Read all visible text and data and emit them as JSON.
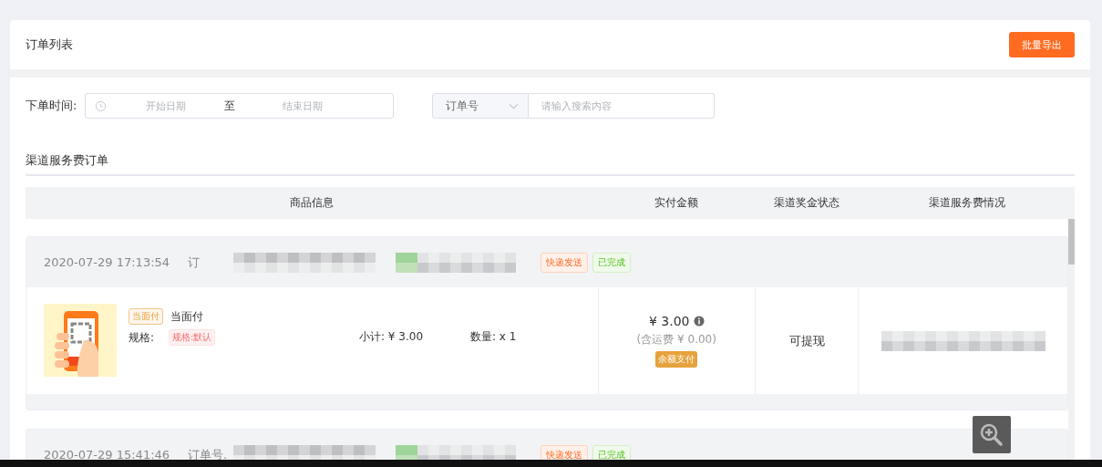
{
  "header": {
    "title": "订单列表",
    "export_button": "批量导出"
  },
  "filters": {
    "date_label": "下单时间:",
    "start_placeholder": "开始日期",
    "separator": "至",
    "end_placeholder": "结束日期",
    "search_type": "订单号",
    "search_placeholder": "请输入搜索内容"
  },
  "section_title": "渠道服务费订单",
  "table": {
    "columns": [
      "商品信息",
      "实付金额",
      "渠道奖金状态",
      "渠道服务费情况"
    ],
    "orders": [
      {
        "time": "2020-07-29 17:13:54",
        "order_label": "订",
        "tags": [
          {
            "text": "快递发送",
            "kind": "shipping"
          },
          {
            "text": "已完成",
            "kind": "done"
          }
        ],
        "detail": {
          "product_badge": "当面付",
          "product_name": "当面付",
          "spec_label": "规格:",
          "spec_tag": "规格:默认",
          "subtotal": "小计: ¥ 3.00",
          "quantity": "数量: x 1",
          "amount": "¥ 3.00",
          "shipping": "(含运费 ¥ 0.00)",
          "payment_badge": "余额支付",
          "bonus_status": "可提现"
        }
      },
      {
        "time": "2020-07-29 15:41:46",
        "order_label": "订单号.",
        "tags": [
          {
            "text": "快递发送",
            "kind": "shipping"
          },
          {
            "text": "已完成",
            "kind": "done"
          }
        ]
      }
    ]
  }
}
